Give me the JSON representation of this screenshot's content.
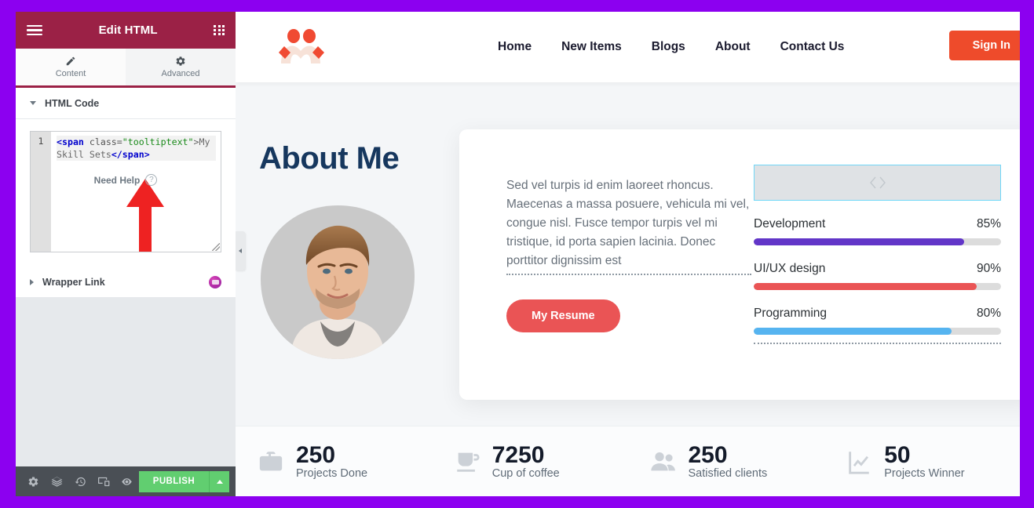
{
  "frame": {
    "border_color": "#8c00f0"
  },
  "panel": {
    "header": {
      "title": "Edit HTML",
      "menu_icon": "hamburger-icon",
      "apps_icon": "grid-apps-icon"
    },
    "tabs": [
      {
        "label": "Content",
        "icon": "pencil-icon",
        "active": true
      },
      {
        "label": "Advanced",
        "icon": "gear-icon",
        "active": false
      }
    ],
    "sections": [
      {
        "label": "HTML Code",
        "expanded": true
      },
      {
        "label": "Wrapper Link",
        "expanded": false,
        "icon": "dynamic-tags-icon"
      }
    ],
    "code_editor": {
      "line_number": "1",
      "tag_open": "<span",
      "attr_name": " class=",
      "attr_value": "\"tooltiptext\"",
      "text_content": ">My Skill Sets",
      "tag_close": "</span>",
      "full_code": "<span class=\"tooltiptext\">My Skill Sets</span>"
    },
    "annotation": {
      "type": "red-arrow",
      "color": "#ee2222"
    },
    "need_help": {
      "label": "Need Help",
      "badge": "?"
    },
    "footer": {
      "icons": [
        "settings-gear-icon",
        "navigator-layers-icon",
        "history-revisions-icon",
        "responsive-mode-icon",
        "preview-eye-icon"
      ],
      "publish_label": "PUBLISH",
      "publish_color": "#61ce70",
      "publish_caret": "caret-up-icon"
    },
    "collapse_handle": "chevron-left-icon"
  },
  "site": {
    "logo": "brand-logo-icon",
    "nav": [
      {
        "label": "Home"
      },
      {
        "label": "New Items"
      },
      {
        "label": "Blogs"
      },
      {
        "label": "About"
      },
      {
        "label": "Contact Us"
      }
    ],
    "signin_label": "Sign In",
    "signin_color": "#ee4b2b",
    "about": {
      "title": "About Me",
      "title_color": "#16375e",
      "portrait": "person-portrait-photo",
      "paragraph": "Sed vel turpis id enim laoreet rhoncus. Maecenas a massa posuere, vehicula mi vel, congue nisl. Fusce tempor turpis vel mi tristique, id porta sapien lacinia. Donec porttitor dignissim est",
      "resume_label": "My Resume",
      "resume_color": "#ea5455"
    },
    "html_widget": {
      "icon": "code-brackets-icon",
      "selected": true,
      "selection_color": "#71d7f7"
    },
    "skills": [
      {
        "label": "Development",
        "value": "85%",
        "percent": 85,
        "color": "#6236c8"
      },
      {
        "label": "UI/UX design",
        "value": "90%",
        "percent": 90,
        "color": "#ea5455"
      },
      {
        "label": "Programming",
        "value": "80%",
        "percent": 80,
        "color": "#56b4f0"
      }
    ],
    "stats": [
      {
        "number": "250",
        "label": "Projects Done",
        "icon": "briefcase-icon"
      },
      {
        "number": "7250",
        "label": "Cup of coffee",
        "icon": "coffee-cup-icon"
      },
      {
        "number": "250",
        "label": "Satisfied clients",
        "icon": "people-icon"
      },
      {
        "number": "50",
        "label": "Projects Winner",
        "icon": "chart-growth-icon"
      }
    ]
  }
}
